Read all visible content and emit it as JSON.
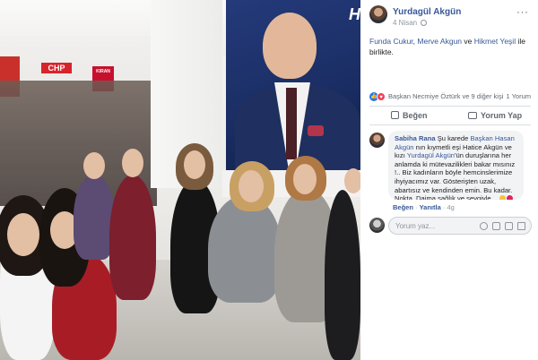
{
  "photo": {
    "banner_party": "CHP",
    "banner_sign": "KIRAN",
    "poster_letter": "H"
  },
  "post": {
    "author": "Yurdagül Akgün",
    "time": "4 Nisan",
    "more": "···",
    "text_tag_1": "Funda Cukur",
    "text_sep_1": ",",
    "text_tag_2": "Merve Akgun",
    "text_mid": "ve",
    "text_tag_3": "Hikmet Yeşil",
    "text_tail": "ile birlikte."
  },
  "reactions": {
    "like_icon": "👍",
    "love_icon": "♥",
    "reactors": "Başkan Necmiye Öztürk ve 9 diğer kişi",
    "comment_count": "1 Yorum"
  },
  "actions": {
    "like_label": "Beğen",
    "comment_label": "Yorum Yap"
  },
  "comment": {
    "author": "Sabiha Rana",
    "part1": "Şu karede",
    "tag1": "Başkan Hasan Akgün",
    "part2": "nın kıymetli eşi Hatice Akgün ve kızı",
    "tag2": "Yurdagül Akgün",
    "part3": "'ün duruşlarına her anlamda ki mütevazilikleri bakar mısınız !.. Biz kadınların böyle hemcinslerimize ihyiyacımız var. Gösterişten uzak, abartısız ve kendinden emin. Bu kadar. Nokta. Daima sağlık ve sevgiyle...",
    "like_action": "Beğen",
    "reply_action": "Yanıtla",
    "age": "4g"
  },
  "write_comment": {
    "placeholder": "Yorum yaz..."
  },
  "icons": [
    "more-icon",
    "globe-icon",
    "thumb-icon",
    "comment-bubble-icon",
    "emoji-icon",
    "camera-icon",
    "gif-icon",
    "sticker-icon"
  ]
}
